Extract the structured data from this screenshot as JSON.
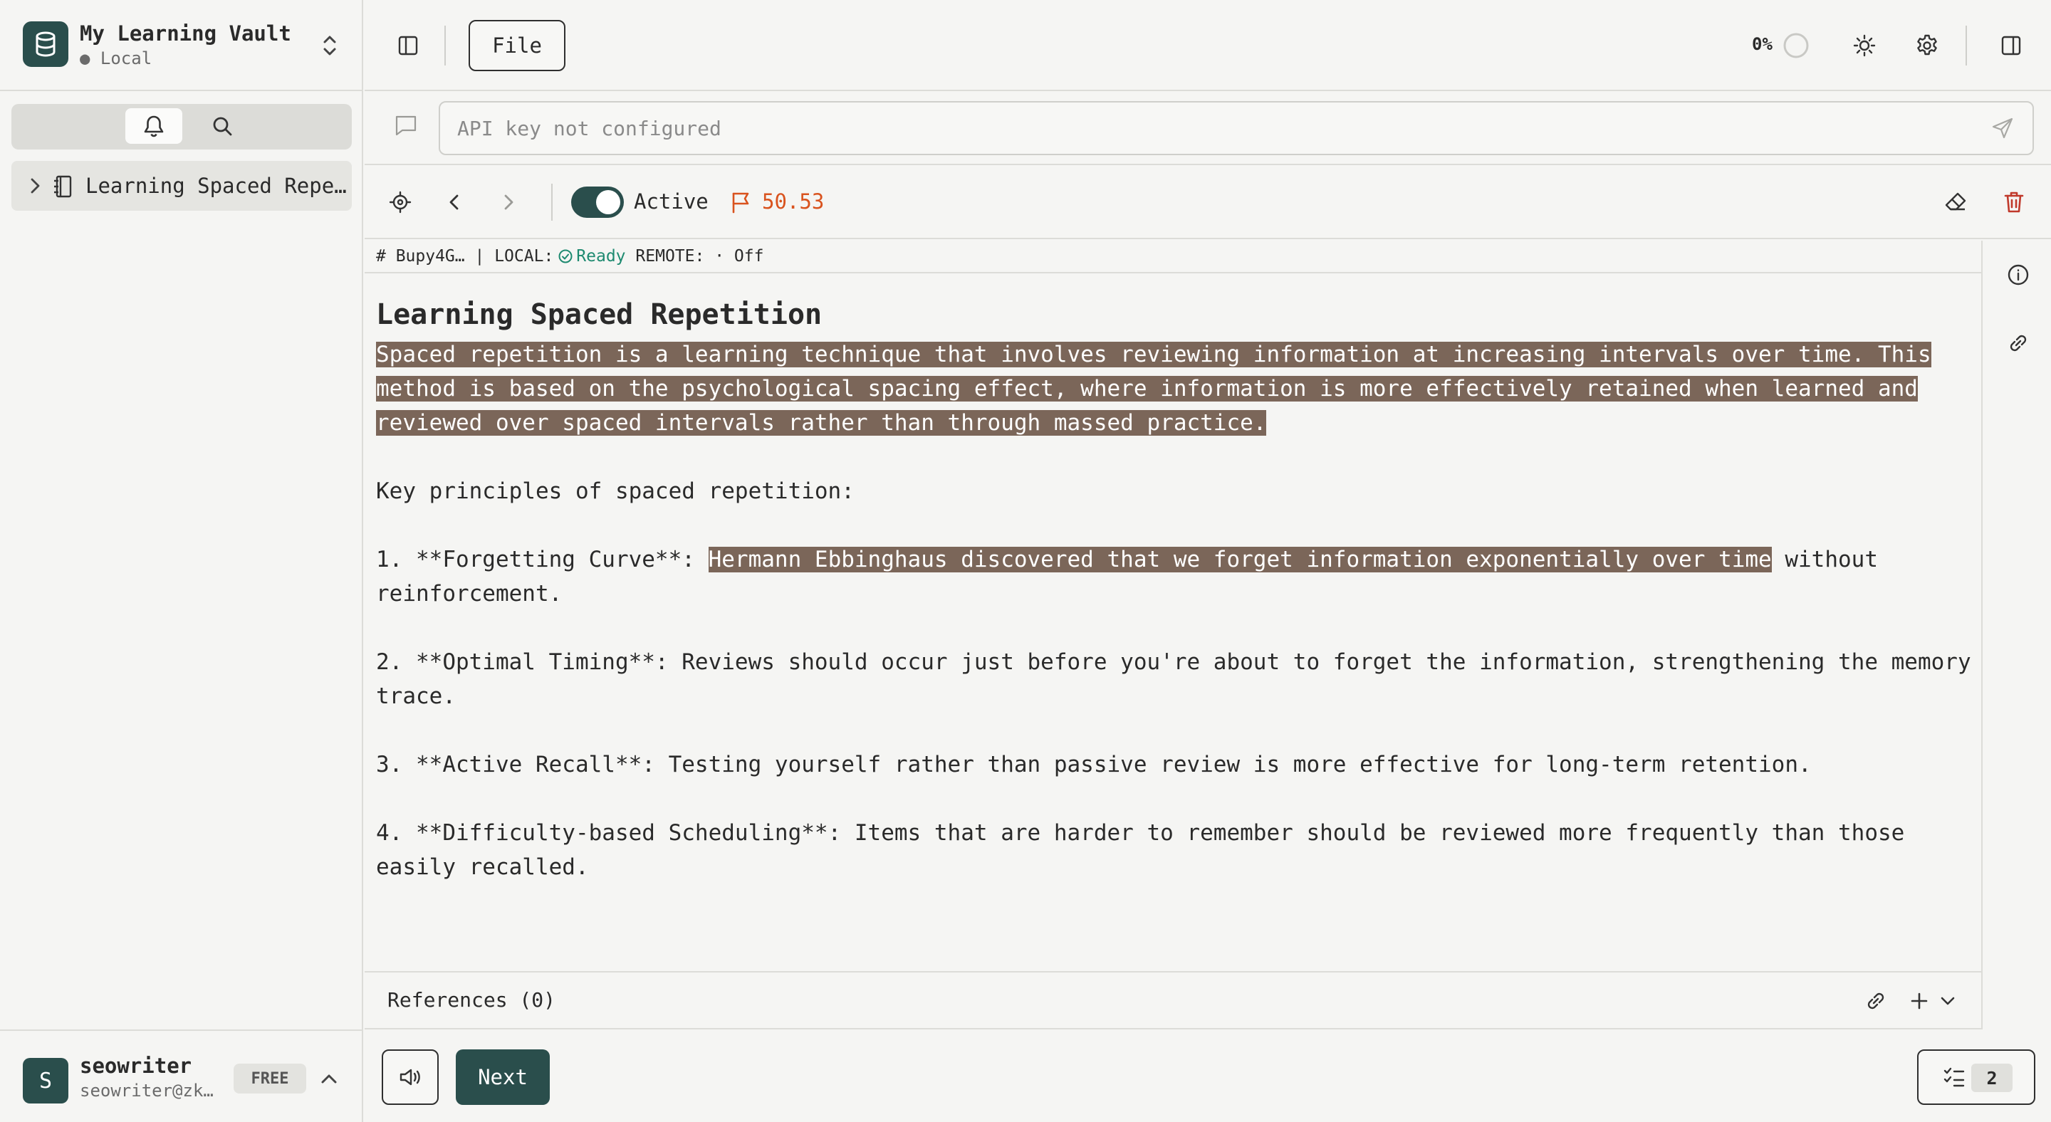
{
  "vault": {
    "name": "My Learning Vault",
    "status": "● Local"
  },
  "sidebar": {
    "tree_items": [
      {
        "label": "Learning Spaced Repe…"
      }
    ]
  },
  "user": {
    "initial": "S",
    "name": "seowriter",
    "email": "seowriter@zk…",
    "plan": "FREE"
  },
  "topbar": {
    "file_label": "File",
    "progress": "0%"
  },
  "chat": {
    "placeholder": "API key not configured",
    "value": ""
  },
  "card_toolbar": {
    "active_label": "Active",
    "active": true,
    "priority": "50.53"
  },
  "meta": {
    "id": "# Bupy4G…",
    "separator": "|",
    "local_label": "LOCAL:",
    "local_status": "Ready",
    "remote_label": "REMOTE:",
    "remote_status": "· Off"
  },
  "card": {
    "title": "Learning Spaced Repetition",
    "intro_highlight": "Spaced repetition is a learning technique that involves reviewing information at increasing intervals over time. This method is based on the psychological spacing effect, where information is more effectively retained when learned and reviewed over spaced intervals rather than through massed practice.",
    "principles_heading": "Key principles of spaced repetition:",
    "p1_prefix": "1. **Forgetting Curve**: ",
    "p1_highlight": "Hermann Ebbinghaus discovered that we forget information exponentially over time",
    "p1_suffix": " without reinforcement.",
    "p2": "2. **Optimal Timing**: Reviews should occur just before you're about to forget the information, strengthening the memory trace.",
    "p3": "3. **Active Recall**: Testing yourself rather than passive review is more effective for long-term retention.",
    "p4": "4. **Difficulty-based Scheduling**: Items that are harder to remember should be reviewed more frequently than those easily recalled."
  },
  "references": {
    "label": "References (0)"
  },
  "bottombar": {
    "next_label": "Next",
    "queue_count": "2"
  },
  "colors": {
    "accent": "#2a4e4c",
    "highlight": "#7b6659",
    "priority": "#d9531e",
    "ready": "#1e8a70",
    "delete": "#c0392b"
  }
}
